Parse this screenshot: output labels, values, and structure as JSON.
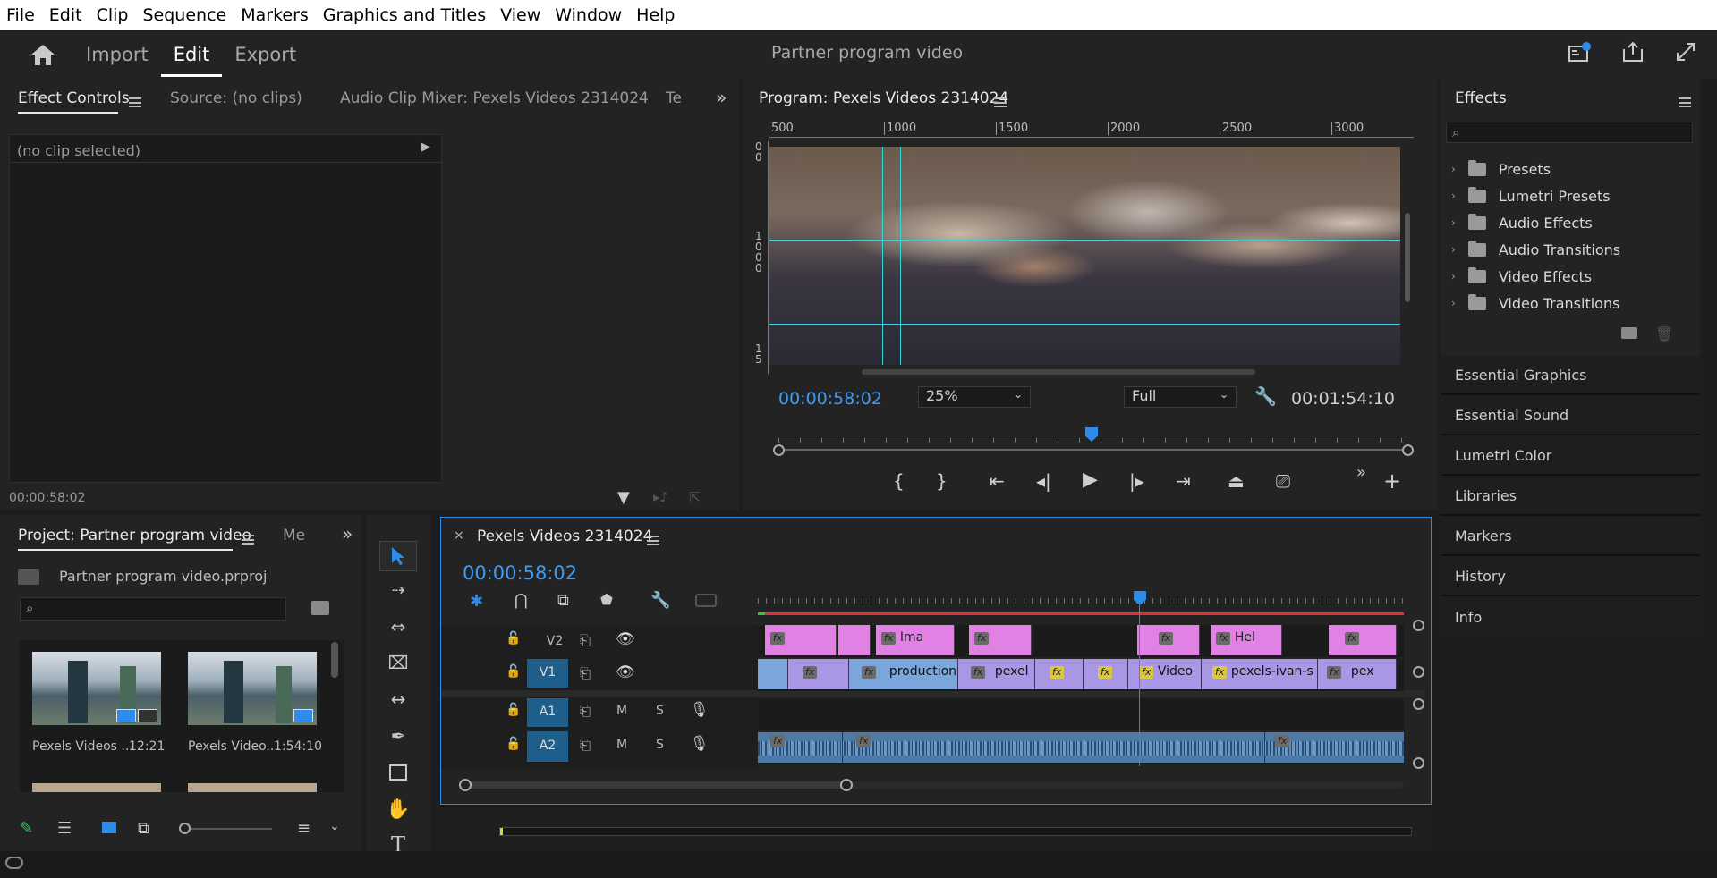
{
  "menu": [
    "File",
    "Edit",
    "Clip",
    "Sequence",
    "Markers",
    "Graphics and Titles",
    "View",
    "Window",
    "Help"
  ],
  "appbar": {
    "tabs": [
      "Import",
      "Edit",
      "Export"
    ],
    "active_tab": "Edit",
    "project_title": "Partner program video"
  },
  "effect_controls": {
    "tabs": [
      "Effect Controls",
      "Source: (no clips)",
      "Audio Clip Mixer: Pexels Videos 2314024",
      "Te"
    ],
    "no_clip": "(no clip selected)",
    "timecode": "00:00:58:02"
  },
  "program_monitor": {
    "title": "Program: Pexels Videos 2314024",
    "ruler": [
      "500",
      "1000",
      "1500",
      "2000",
      "2500",
      "3000"
    ],
    "vruler_top": "0\n0",
    "vruler_mid": "1\n0\n0\n0",
    "vruler_bot": "1\n5",
    "timecode": "00:00:58:02",
    "zoom": "25%",
    "resolution": "Full",
    "duration": "00:01:54:10",
    "playhead_fraction": 0.5
  },
  "project": {
    "title": "Project: Partner program video",
    "next_tab": "Me",
    "file": "Partner program video.prproj",
    "items": [
      {
        "name": "Pexels Videos ...",
        "duration": "12:21"
      },
      {
        "name": "Pexels Video...",
        "duration": "1:54:10"
      }
    ]
  },
  "timeline": {
    "sequence": "Pexels Videos 2314024",
    "timecode": "00:00:58:02",
    "tracks": {
      "v2": "V2",
      "v1": "V1",
      "a1": "A1",
      "a2": "A2",
      "m": "M",
      "s": "S"
    },
    "v2_clips": [
      "Ima",
      "Hel"
    ],
    "v1_clips": [
      "production l",
      "pexel",
      "Video",
      "pexels-ivan-s",
      "pex"
    ]
  },
  "effects": {
    "title": "Effects",
    "folders": [
      "Presets",
      "Lumetri Presets",
      "Audio Effects",
      "Audio Transitions",
      "Video Effects",
      "Video Transitions"
    ]
  },
  "side_panels": [
    "Essential Graphics",
    "Essential Sound",
    "Lumetri Color",
    "Libraries",
    "Markers",
    "History",
    "Info"
  ],
  "colors": {
    "accent": "#2d8ceb",
    "v2_clip": "#e081e3",
    "v1_clip": "#a997e6",
    "audio": "#4d7aa7",
    "guide": "#35d6d6"
  }
}
